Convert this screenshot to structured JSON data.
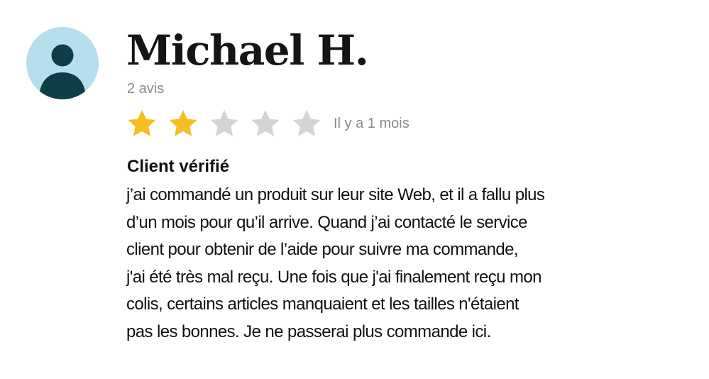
{
  "reviewer": {
    "name": "Michael H.",
    "review_count": "2 avis",
    "avatar_icon": "user-silhouette-icon",
    "avatar_bg": "#b5deee",
    "avatar_fg": "#0d3e48"
  },
  "rating": {
    "value": 2,
    "max": 5,
    "filled_color": "#f7bd23",
    "empty_color": "#d4d4d4",
    "date": "Il y a 1 mois"
  },
  "review": {
    "verified_label": "Client vérifié",
    "lines": [
      "j’ai commandé un produit sur leur site Web, et il a fallu plus",
      "d’un mois pour qu’il arrive. Quand j’ai contacté le service",
      "client pour obtenir de l’aide pour suivre ma commande,",
      "j'ai été très mal reçu. Une fois que j'ai finalement reçu mon",
      "colis, certains articles manquaient et les tailles n'étaient",
      "pas les bonnes. Je ne passerai plus commande ici."
    ]
  }
}
